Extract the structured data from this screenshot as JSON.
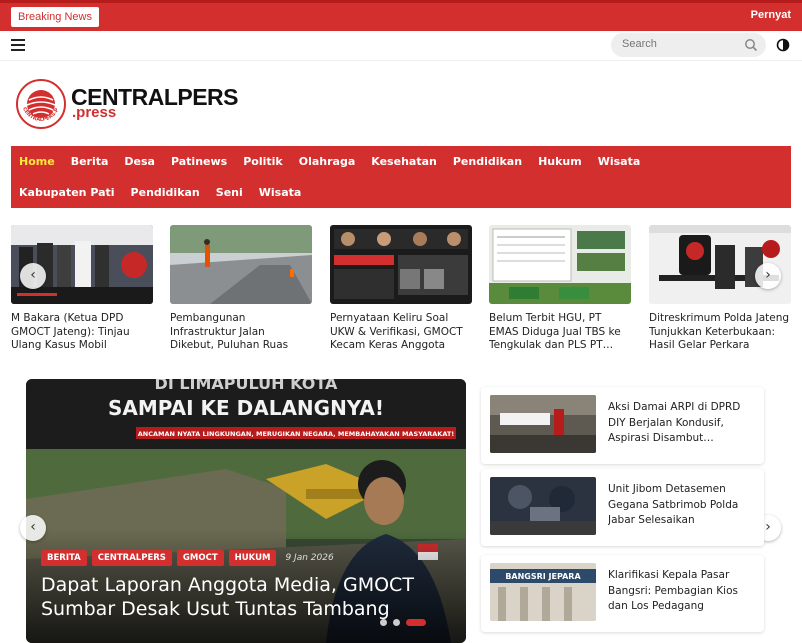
{
  "breaking": {
    "label": "Breaking News",
    "ticker": "Pernyat"
  },
  "search": {
    "placeholder": "Search"
  },
  "logo": {
    "name": "CENTRALPERS",
    "sub": ".press",
    "ring_text": "CENTRALPERS.PRESS"
  },
  "nav": {
    "row1": [
      "Home",
      "Berita",
      "Desa",
      "Patinews",
      "Politik",
      "Olahraga",
      "Kesehatan",
      "Pendidikan",
      "Hukum",
      "Wisata"
    ],
    "row2": [
      "Kabupaten Pati",
      "Pendidikan",
      "Seni",
      "Wisata"
    ],
    "active": "Home"
  },
  "cards": [
    {
      "title": "M Bakara (Ketua DPD GMOCT Jateng): Tinjau Ulang Kasus Mobil Honda…"
    },
    {
      "title": "Pembangunan Infrastruktur Jalan Dikebut, Puluhan Ruas Jalan di Pati Mulai…"
    },
    {
      "title": "Pernyataan Keliru Soal UKW & Verifikasi, GMOCT Kecam Keras Anggota PWI…"
    },
    {
      "title": "Belum Terbit HGU, PT EMAS Diduga Jual TBS ke Tengkulak dan PLS PT…"
    },
    {
      "title": "Ditreskrimum Polda Jateng Tunjukkan Keterbukaan: Hasil Gelar Perkara Khusus…"
    }
  ],
  "featured": {
    "banner_line1": "DI LIMAPULUH KOTA",
    "banner_line2": "SAMPAI KE DALANGNYA!",
    "banner_line3": "ANCAMAN NYATA LINGKUNGAN, MERUGIKAN NEGARA, MEMBAHAYAKAN MASYARAKAT!",
    "tags": [
      "BERITA",
      "CENTRALPERS",
      "GMOCT",
      "HUKUM"
    ],
    "date": "9 Jan 2026",
    "title": "Dapat Laporan Anggota Media, GMOCT Sumbar Desak Usut Tuntas Tambang Ema…"
  },
  "side": [
    {
      "title": "Aksi Damai ARPI di DPRD DIY Berjalan Kondusif, Aspirasi Disambut…"
    },
    {
      "title": "Unit Jibom Detasemen Gegana Satbrimob Polda Jabar Selesaikan Penanganan Amunisi…"
    },
    {
      "title": "Klarifikasi Kepala Pasar Bangsri: Pembagian Kios dan Los Pedagang Dilakukan…",
      "sign": "BANGSRI JEPARA"
    }
  ],
  "colors": {
    "accent": "#d32f2f",
    "nav_active": "#ffeb3b"
  },
  "arrows": {
    "prev": "‹",
    "next": "›"
  }
}
